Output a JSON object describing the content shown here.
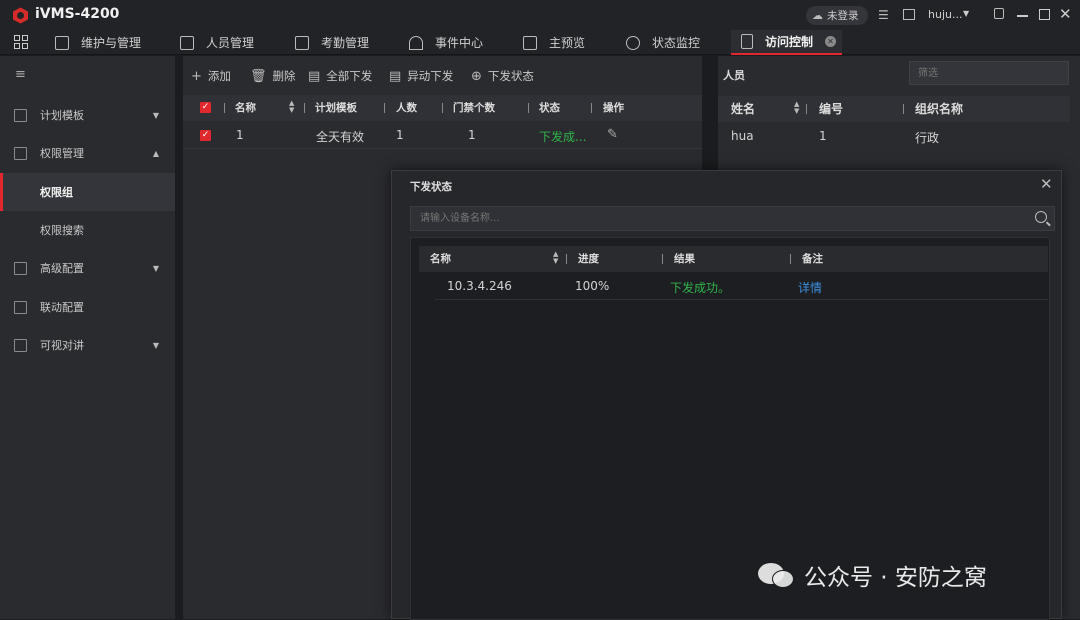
{
  "app": {
    "title": "iVMS-4200",
    "login_status": "未登录",
    "user": "huju..."
  },
  "tabs": [
    {
      "label": "维护与管理"
    },
    {
      "label": "人员管理"
    },
    {
      "label": "考勤管理"
    },
    {
      "label": "事件中心"
    },
    {
      "label": "主预览"
    },
    {
      "label": "状态监控"
    },
    {
      "label": "访问控制"
    }
  ],
  "sidebar": {
    "items": [
      {
        "label": "计划模板"
      },
      {
        "label": "权限管理"
      },
      {
        "label": "权限组"
      },
      {
        "label": "权限搜索"
      },
      {
        "label": "高级配置"
      },
      {
        "label": "联动配置"
      },
      {
        "label": "可视对讲"
      }
    ]
  },
  "toolbar": {
    "add": "添加",
    "delete": "删除",
    "all_issue": "全部下发",
    "abnormal_issue": "异动下发",
    "issue_status": "下发状态"
  },
  "group_table": {
    "headers": [
      "名称",
      "计划模板",
      "人数",
      "门禁个数",
      "状态",
      "操作"
    ],
    "rows": [
      {
        "name": "1",
        "template": "全天有效",
        "people": "1",
        "doors": "1",
        "status": "下发成..."
      }
    ]
  },
  "person_panel": {
    "title": "人员",
    "filter_placeholder": "筛选",
    "headers": [
      "姓名",
      "编号",
      "组织名称"
    ],
    "rows": [
      {
        "name": "hua",
        "id": "1",
        "org": "行政"
      }
    ]
  },
  "dialog": {
    "title": "下发状态",
    "search_placeholder": "请输入设备名称...",
    "headers": [
      "名称",
      "进度",
      "结果",
      "备注"
    ],
    "rows": [
      {
        "device": "10.3.4.246",
        "progress": "100%",
        "result": "下发成功。",
        "note": "详情"
      }
    ]
  },
  "watermark": "公众号 · 安防之窝",
  "colors": {
    "accent": "#e0282e",
    "success": "#2fb34a",
    "link": "#3d8fe0"
  }
}
